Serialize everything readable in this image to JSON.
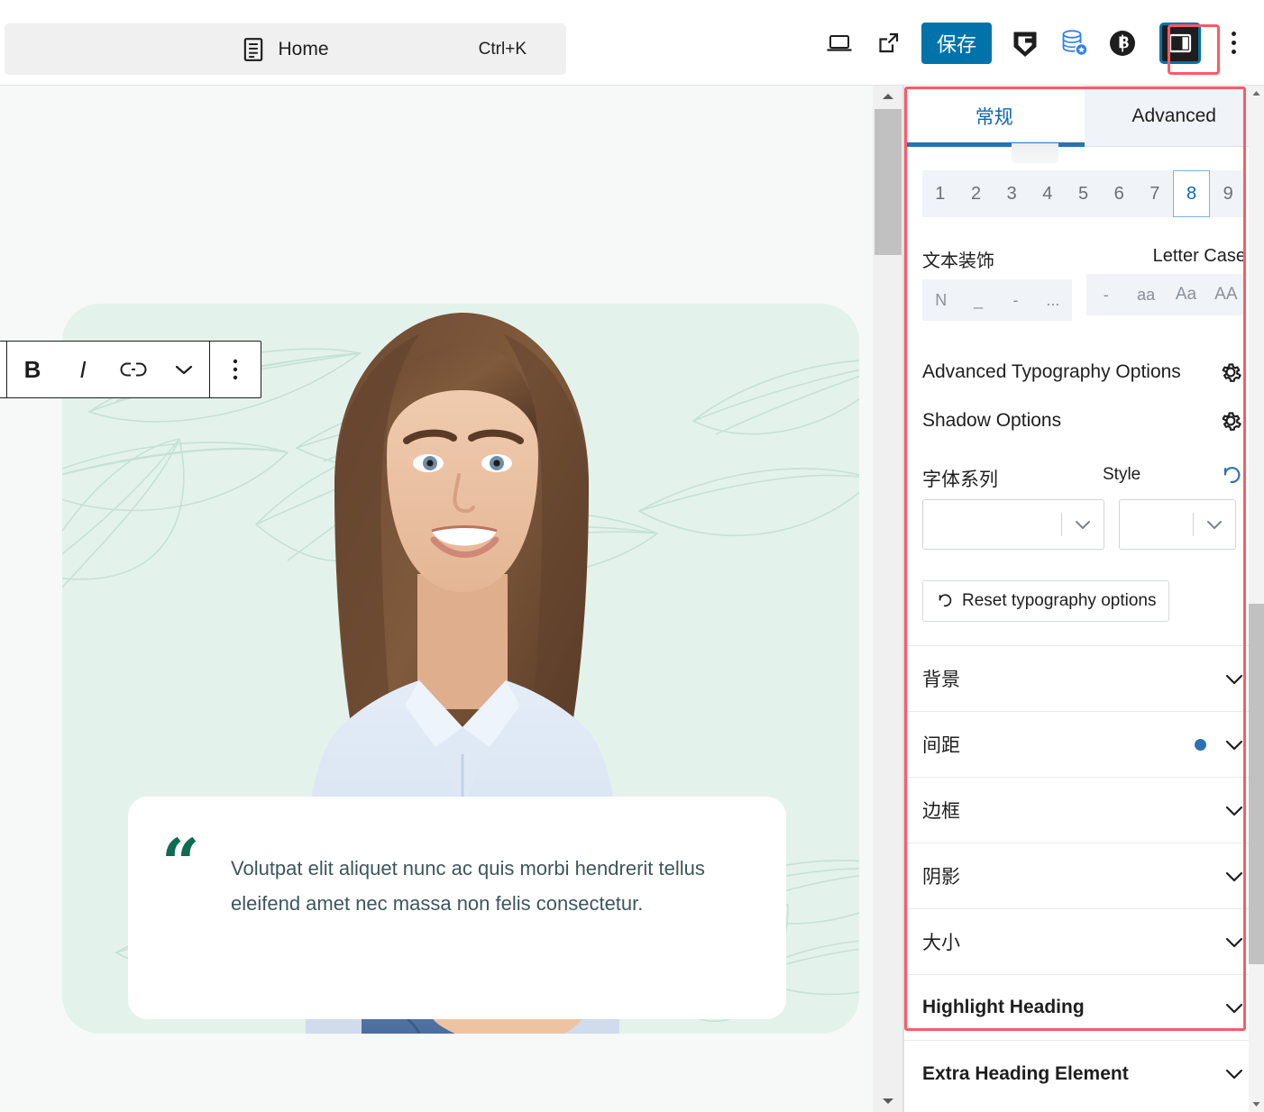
{
  "header": {
    "command_palette": {
      "icon": "document-icon",
      "label": "Home",
      "shortcut": "Ctrl+K"
    },
    "actions": [
      {
        "name": "preview-desktop-button",
        "icon": "laptop-icon"
      },
      {
        "name": "view-external-button",
        "icon": "external-link-icon"
      },
      {
        "name": "save-button",
        "label": "保存"
      },
      {
        "name": "grammarly-button",
        "icon": "grammarly-g-icon"
      },
      {
        "name": "database-backup-button",
        "icon": "database-star-icon"
      },
      {
        "name": "bitly-button",
        "icon": "bitly-b-icon"
      },
      {
        "name": "sidebar-toggle-button",
        "icon": "sidebar-panel-icon"
      },
      {
        "name": "more-options-button",
        "icon": "kebab-menu-icon"
      }
    ],
    "save_label": "保存"
  },
  "canvas": {
    "block_toolbar": {
      "buttons": [
        {
          "name": "bold-button",
          "label": "B"
        },
        {
          "name": "italic-button",
          "label": "I"
        },
        {
          "name": "link-button",
          "icon": "link-icon"
        },
        {
          "name": "more-rich-text-button",
          "icon": "chevron-down-icon"
        },
        {
          "name": "block-options-button",
          "icon": "kebab-menu-icon"
        }
      ]
    },
    "quote": {
      "mark": "“",
      "text": "Volutpat elit aliquet nunc ac quis morbi hendrerit tellus eleifend amet nec massa non felis consectetur."
    }
  },
  "sidebar": {
    "tabs": [
      {
        "name": "tab-general",
        "label": "常规",
        "active": true
      },
      {
        "name": "tab-advanced",
        "label": "Advanced",
        "active": false
      }
    ],
    "number_strip": {
      "values": [
        "1",
        "2",
        "3",
        "4",
        "5",
        "6",
        "7",
        "8",
        "9"
      ],
      "selected": "8"
    },
    "text_decoration": {
      "label": "文本装饰",
      "options": [
        "N",
        "_",
        "-",
        "..."
      ]
    },
    "letter_case": {
      "label": "Letter Case",
      "options": [
        "-",
        "aa",
        "Aa",
        "AA"
      ]
    },
    "option_rows": [
      {
        "name": "advanced-typography-options-row",
        "label": "Advanced Typography Options",
        "icon": "gear-icon"
      },
      {
        "name": "shadow-options-row",
        "label": "Shadow Options",
        "icon": "gear-icon"
      }
    ],
    "font": {
      "family_label": "字体系列",
      "style_label": "Style",
      "family_value": "",
      "style_value": "",
      "reset_icon": "reset-arrow-icon"
    },
    "reset_typography": {
      "label": "Reset typography options",
      "icon": "reset-arrow-icon"
    },
    "accordions": [
      {
        "name": "accordion-background",
        "label": "背景",
        "has_dot": false
      },
      {
        "name": "accordion-spacing",
        "label": "间距",
        "has_dot": true
      },
      {
        "name": "accordion-border",
        "label": "边框",
        "has_dot": false
      },
      {
        "name": "accordion-shadow",
        "label": "阴影",
        "has_dot": false
      },
      {
        "name": "accordion-size",
        "label": "大小",
        "has_dot": false
      },
      {
        "name": "accordion-highlight-heading",
        "label": "Highlight Heading",
        "has_dot": false
      },
      {
        "name": "accordion-extra-heading-element",
        "label": "Extra Heading Element",
        "has_dot": false
      }
    ]
  },
  "colors": {
    "accent_blue": "#0073aa",
    "tab_active_underline": "#2b72b0",
    "highlight_red": "#ff5a67",
    "quote_green": "#0f6b52",
    "card_bg": "#e4f2ec",
    "dot_blue": "#2b72b0"
  }
}
